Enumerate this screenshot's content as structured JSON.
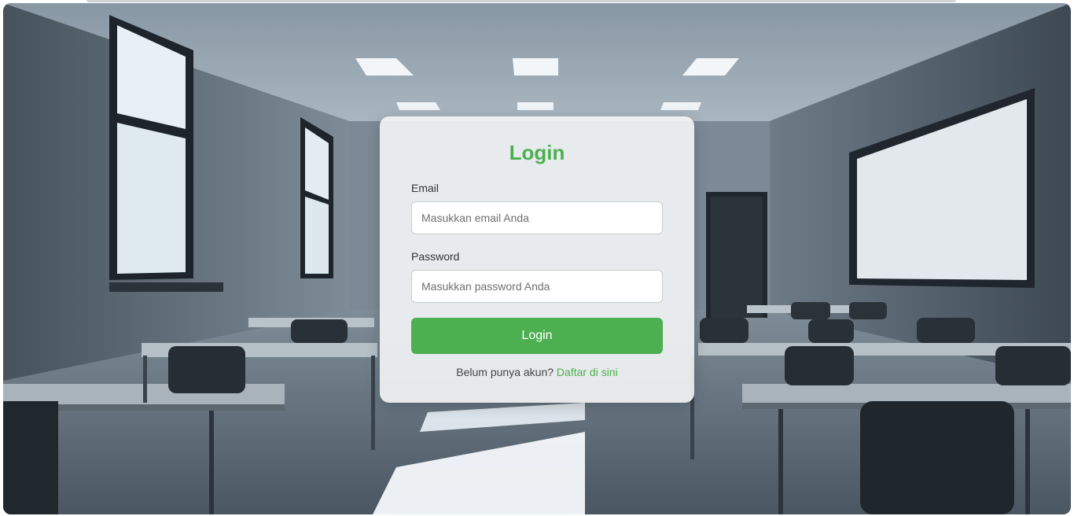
{
  "login_card": {
    "title": "Login",
    "email_label": "Email",
    "email_placeholder": "Masukkan email Anda",
    "email_value": "",
    "password_label": "Password",
    "password_placeholder": "Masukkan password Anda",
    "password_value": "",
    "submit_label": "Login",
    "register_prompt": "Belum punya akun?",
    "register_link_label": "Daftar di sini"
  },
  "theme": {
    "accent_color": "#4caf50",
    "card_background": "#f4f5f6",
    "background_image": "empty-classroom-photo"
  }
}
